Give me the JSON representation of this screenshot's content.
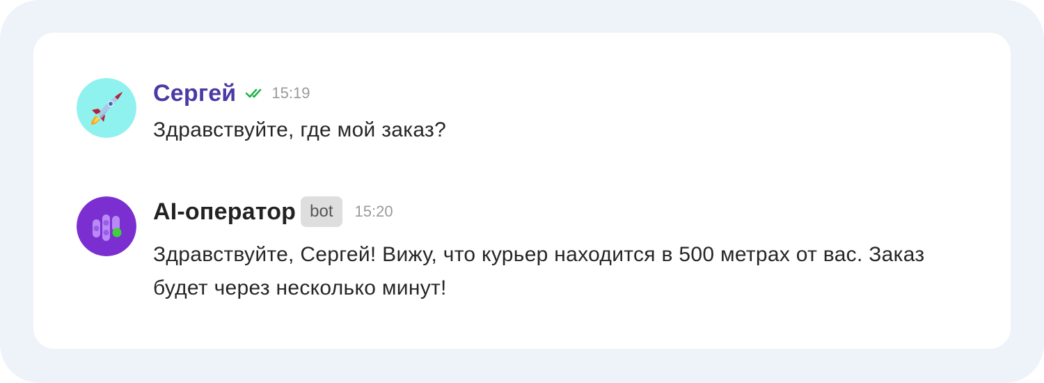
{
  "messages": [
    {
      "author": "Сергей",
      "time": "15:19",
      "text": "Здравствуйте, где мой заказ?",
      "avatar_icon": "rocket-icon",
      "status_icon": "double-check-icon",
      "avatar_color": "#8ff2ee",
      "author_color": "#4a3aa6"
    },
    {
      "author": "AI-оператор",
      "badge": "bot",
      "time": "15:20",
      "text": "Здравствуйте, Сергей! Вижу, что курьер находится в 500 метрах от вас. Заказ будет через несколько минут!",
      "avatar_icon": "ai-operator-logo-icon",
      "avatar_color": "#7b2fd1"
    }
  ],
  "colors": {
    "frame_background": "#eef3fa",
    "card_background": "#ffffff",
    "check_color": "#23b24b",
    "badge_background": "#dedede"
  }
}
